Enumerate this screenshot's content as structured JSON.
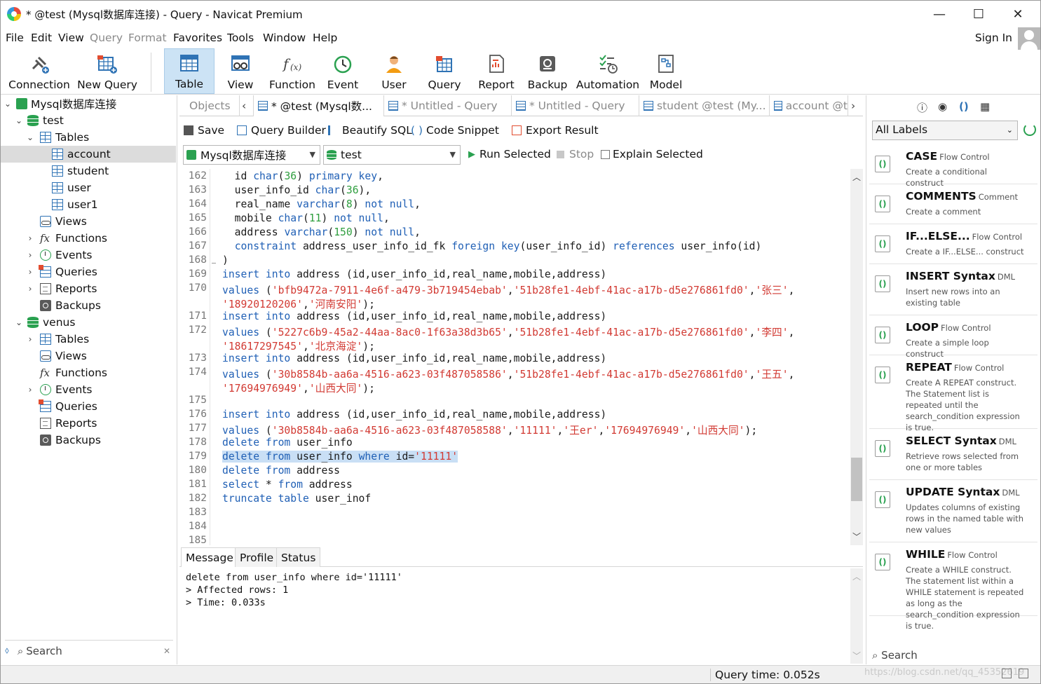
{
  "window": {
    "title": "* @test (Mysql数据库连接) - Query - Navicat Premium",
    "controls": {
      "minimize": "—",
      "maximize": "☐",
      "close": "✕"
    }
  },
  "menu": {
    "items": [
      {
        "label": "File",
        "dim": false
      },
      {
        "label": "Edit",
        "dim": false
      },
      {
        "label": "View",
        "dim": false
      },
      {
        "label": "Query",
        "dim": true
      },
      {
        "label": "Format",
        "dim": true
      },
      {
        "label": "Favorites",
        "dim": false
      },
      {
        "label": "Tools",
        "dim": false
      },
      {
        "label": "Window",
        "dim": false
      },
      {
        "label": "Help",
        "dim": false
      }
    ],
    "sign_in": "Sign In"
  },
  "toolbar": {
    "items": [
      "Connection",
      "New Query",
      "Table",
      "View",
      "Function",
      "Event",
      "User",
      "Query",
      "Report",
      "Backup",
      "Automation",
      "Model"
    ],
    "active": "Table"
  },
  "navigator": {
    "connection": "Mysql数据库连接",
    "db1": {
      "name": "test",
      "tables": "Tables",
      "table_items": [
        "account",
        "student",
        "user",
        "user1"
      ],
      "views": "Views",
      "functions": "Functions",
      "events": "Events",
      "queries": "Queries",
      "reports": "Reports",
      "backups": "Backups"
    },
    "db2": {
      "name": "venus",
      "tables": "Tables",
      "views": "Views",
      "functions": "Functions",
      "events": "Events",
      "queries": "Queries",
      "reports": "Reports",
      "backups": "Backups"
    },
    "search_placeholder": "Search"
  },
  "tabs": [
    "Objects",
    "* @test (Mysql数...",
    "* Untitled - Query",
    "* Untitled - Query",
    "student @test (My...",
    "account @t"
  ],
  "actions": {
    "save": "Save",
    "query_builder": "Query Builder",
    "beautify": "Beautify SQL",
    "snippet": "Code Snippet",
    "export": "Export Result"
  },
  "selectors": {
    "connection": "Mysql数据库连接",
    "database": "test",
    "run_selected": "Run Selected",
    "stop": "Stop",
    "explain": "Explain Selected"
  },
  "editor": {
    "line_numbers": [
      "162",
      "163",
      "164",
      "165",
      "166",
      "167",
      "168",
      "169",
      "170",
      "",
      "171",
      "172",
      "",
      "173",
      "174",
      "",
      "175",
      "176",
      "177",
      "178",
      "179",
      "180",
      "181",
      "182",
      "183",
      "184",
      "185"
    ],
    "lines": [
      [
        [
          "  id ",
          ""
        ],
        [
          "char",
          "k"
        ],
        [
          "(",
          ""
        ],
        [
          "36",
          "g"
        ],
        [
          ") ",
          ""
        ],
        [
          "primary key",
          "k"
        ],
        [
          ",",
          ""
        ]
      ],
      [
        [
          "  user_info_id ",
          ""
        ],
        [
          "char",
          "k"
        ],
        [
          "(",
          ""
        ],
        [
          "36",
          "g"
        ],
        [
          "),",
          ""
        ]
      ],
      [
        [
          "  real_name ",
          ""
        ],
        [
          "varchar",
          "k"
        ],
        [
          "(",
          ""
        ],
        [
          "8",
          "g"
        ],
        [
          ") ",
          ""
        ],
        [
          "not null",
          "k"
        ],
        [
          ",",
          ""
        ]
      ],
      [
        [
          "  mobile ",
          ""
        ],
        [
          "char",
          "k"
        ],
        [
          "(",
          ""
        ],
        [
          "11",
          "g"
        ],
        [
          ") ",
          ""
        ],
        [
          "not null",
          "k"
        ],
        [
          ",",
          ""
        ]
      ],
      [
        [
          "  address ",
          ""
        ],
        [
          "varchar",
          "k"
        ],
        [
          "(",
          ""
        ],
        [
          "150",
          "g"
        ],
        [
          ") ",
          ""
        ],
        [
          "not null",
          "k"
        ],
        [
          ",",
          ""
        ]
      ],
      [
        [
          "  ",
          ""
        ],
        [
          "constraint",
          "k"
        ],
        [
          " address_user_info_id_fk ",
          ""
        ],
        [
          "foreign key",
          "k"
        ],
        [
          "(user_info_id) ",
          ""
        ],
        [
          "references",
          "k"
        ],
        [
          " user_info(id)",
          ""
        ]
      ],
      [
        [
          ")",
          ""
        ]
      ],
      [
        [
          "insert into",
          "k"
        ],
        [
          " address (id,user_info_id,real_name,mobile,address)",
          ""
        ]
      ],
      [
        [
          "values",
          "k"
        ],
        [
          " (",
          ""
        ],
        [
          "'bfb9472a-7911-4e6f-a479-3b719454ebab'",
          "s"
        ],
        [
          ",",
          ""
        ],
        [
          "'51b28fe1-4ebf-41ac-a17b-d5e276861fd0'",
          "s"
        ],
        [
          ",",
          ""
        ],
        [
          "'张三'",
          "s"
        ],
        [
          ",",
          ""
        ]
      ],
      [
        [
          "'18920120206'",
          "s"
        ],
        [
          ",",
          ""
        ],
        [
          "'河南安阳'",
          "s"
        ],
        [
          ");",
          ""
        ]
      ],
      [
        [
          "insert into",
          "k"
        ],
        [
          " address (id,user_info_id,real_name,mobile,address)",
          ""
        ]
      ],
      [
        [
          "values",
          "k"
        ],
        [
          " (",
          ""
        ],
        [
          "'5227c6b9-45a2-44aa-8ac0-1f63a38d3b65'",
          "s"
        ],
        [
          ",",
          ""
        ],
        [
          "'51b28fe1-4ebf-41ac-a17b-d5e276861fd0'",
          "s"
        ],
        [
          ",",
          ""
        ],
        [
          "'李四'",
          "s"
        ],
        [
          ",",
          ""
        ]
      ],
      [
        [
          "'18617297545'",
          "s"
        ],
        [
          ",",
          ""
        ],
        [
          "'北京海淀'",
          "s"
        ],
        [
          ");",
          ""
        ]
      ],
      [
        [
          "insert into",
          "k"
        ],
        [
          " address (id,user_info_id,real_name,mobile,address)",
          ""
        ]
      ],
      [
        [
          "values",
          "k"
        ],
        [
          " (",
          ""
        ],
        [
          "'30b8584b-aa6a-4516-a623-03f487058586'",
          "s"
        ],
        [
          ",",
          ""
        ],
        [
          "'51b28fe1-4ebf-41ac-a17b-d5e276861fd0'",
          "s"
        ],
        [
          ",",
          ""
        ],
        [
          "'王五'",
          "s"
        ],
        [
          ",",
          ""
        ]
      ],
      [
        [
          "'17694976949'",
          "s"
        ],
        [
          ",",
          ""
        ],
        [
          "'山西大同'",
          "s"
        ],
        [
          ");",
          ""
        ]
      ],
      [],
      [
        [
          "insert into",
          "k"
        ],
        [
          " address (id,user_info_id,real_name,mobile,address)",
          ""
        ]
      ],
      [
        [
          "values",
          "k"
        ],
        [
          " (",
          ""
        ],
        [
          "'30b8584b-aa6a-4516-a623-03f487058588'",
          "s"
        ],
        [
          ",",
          ""
        ],
        [
          "'11111'",
          "s"
        ],
        [
          ",",
          ""
        ],
        [
          "'王er'",
          "s"
        ],
        [
          ",",
          ""
        ],
        [
          "'17694976949'",
          "s"
        ],
        [
          ",",
          ""
        ],
        [
          "'山西大同'",
          "s"
        ],
        [
          ");",
          ""
        ]
      ],
      [
        [
          "delete from",
          "k"
        ],
        [
          " user_info",
          ""
        ]
      ],
      [
        [
          "delete from",
          "k"
        ],
        [
          " user_info ",
          ""
        ],
        [
          "where",
          "k"
        ],
        [
          " id=",
          ""
        ],
        [
          "'11111'",
          "s"
        ]
      ],
      [
        [
          "delete from",
          "k"
        ],
        [
          " address",
          ""
        ]
      ],
      [
        [
          "select",
          "k"
        ],
        [
          " * ",
          ""
        ],
        [
          "from",
          "k"
        ],
        [
          " address",
          ""
        ]
      ],
      [
        [
          "truncate table",
          "k"
        ],
        [
          " user_inof",
          ""
        ]
      ],
      [],
      [],
      []
    ],
    "selected_line": "179"
  },
  "message_tabs": [
    "Message",
    "Profile",
    "Status"
  ],
  "messages": [
    "delete from user_info where id='11111'",
    "> Affected rows: 1",
    "> Time: 0.033s"
  ],
  "status": {
    "query_time": "Query time: 0.052s",
    "watermark": "https://blog.csdn.net/qq_45352619"
  },
  "snippets": {
    "filter": "All Labels",
    "items": [
      {
        "title": "CASE",
        "cat": "Flow Control",
        "desc": "Create a conditional construct"
      },
      {
        "title": "COMMENTS",
        "cat": "Comment",
        "desc": "Create a comment"
      },
      {
        "title": "IF...ELSE...",
        "cat": "Flow Control",
        "desc": "Create a IF...ELSE... construct"
      },
      {
        "title": "INSERT Syntax",
        "cat": "DML",
        "desc": "Insert new rows into an existing table"
      },
      {
        "title": "LOOP",
        "cat": "Flow Control",
        "desc": "Create a simple loop construct"
      },
      {
        "title": "REPEAT",
        "cat": "Flow Control",
        "desc": "Create A REPEAT construct. The Statement list is repeated until the search_condition expression is true."
      },
      {
        "title": "SELECT Syntax",
        "cat": "DML",
        "desc": "Retrieve rows selected from one or more tables"
      },
      {
        "title": "UPDATE Syntax",
        "cat": "DML",
        "desc": "Updates columns of existing rows in the named table with new values"
      },
      {
        "title": "WHILE",
        "cat": "Flow Control",
        "desc": "Create a WHILE construct. The statement list within a WHILE statement is repeated as long as the search_condition expression is true."
      }
    ],
    "search_placeholder": "Search"
  },
  "colors": {
    "keyword": "#1f5fb5",
    "number": "#2e9e3e",
    "string": "#d23a33",
    "selection": "#c9dff5",
    "active_tab": "#cce3f5"
  }
}
